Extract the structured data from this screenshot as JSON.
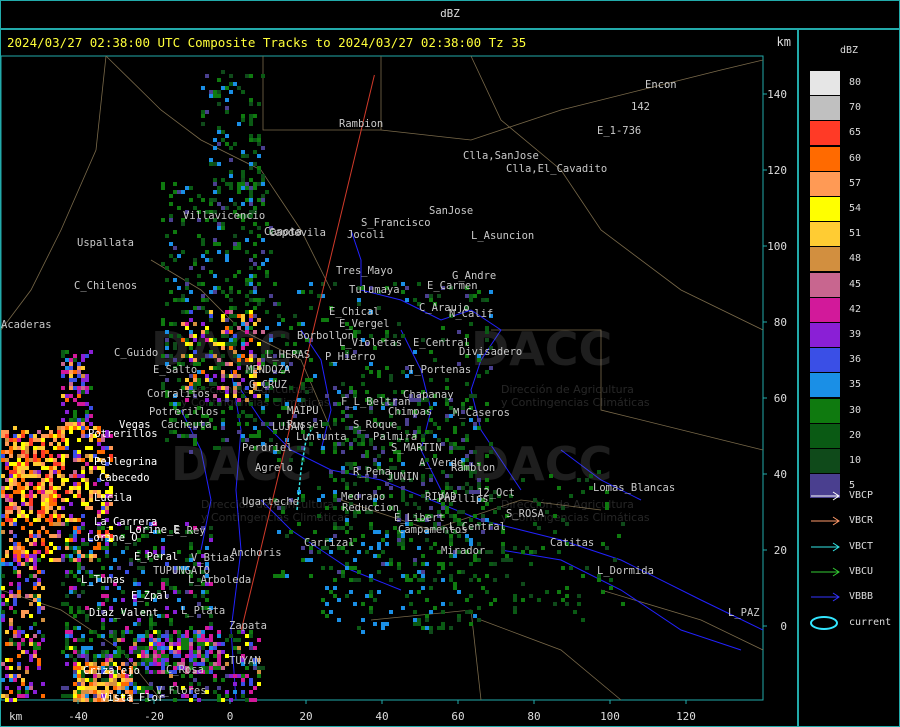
{
  "header": {
    "title": "dBZ"
  },
  "map": {
    "title": "2024/03/27 02:38:00 UTC Composite Tracks to 2024/03/27 02:38:00 Tz 35",
    "unit_top": "km",
    "unit_bottom": "km",
    "x_ticks": [
      "-40",
      "-20",
      "0",
      "20",
      "40",
      "60",
      "80",
      "100",
      "120"
    ],
    "y_ticks": [
      "140",
      "120",
      "100",
      "80",
      "60",
      "40",
      "20",
      "0"
    ],
    "watermark": "DACC",
    "watermark_subtitle_1": "Dirección de Agricultura",
    "watermark_subtitle_2": "y Contingencias Climáticas",
    "places": [
      {
        "name": "Encon"
      },
      {
        "name": "142"
      },
      {
        "name": "E_1-736"
      },
      {
        "name": "Rambion"
      },
      {
        "name": "Clla,SanJose"
      },
      {
        "name": "Clla,El_Cavadito"
      },
      {
        "name": "Villavicencio"
      },
      {
        "name": "Canota"
      },
      {
        "name": "Uspallata"
      },
      {
        "name": "S_Francisco"
      },
      {
        "name": "Jocoli"
      },
      {
        "name": "Capdevila"
      },
      {
        "name": "SanJose"
      },
      {
        "name": "L_Asuncion"
      },
      {
        "name": "Tres_Mayo"
      },
      {
        "name": "G_Andre"
      },
      {
        "name": "E_Carmen"
      },
      {
        "name": "Tulumaya"
      },
      {
        "name": "C_Chilenos"
      },
      {
        "name": "E_Chical"
      },
      {
        "name": "C_Araujo"
      },
      {
        "name": "E_Vergel"
      },
      {
        "name": "N_Calif"
      },
      {
        "name": "Borbollon"
      },
      {
        "name": "L_Violetas"
      },
      {
        "name": "E_Central"
      },
      {
        "name": "C_Guido"
      },
      {
        "name": "L_HERAS"
      },
      {
        "name": "P_Hierro"
      },
      {
        "name": "Divisadero"
      },
      {
        "name": "MENDOZA"
      },
      {
        "name": "E_Salto"
      },
      {
        "name": "T_Portenas"
      },
      {
        "name": "G_CRUZ"
      },
      {
        "name": "Corralitos"
      },
      {
        "name": "Chapanay"
      },
      {
        "name": "F_L_Beltran"
      },
      {
        "name": "Potrerillos"
      },
      {
        "name": "MAIPU"
      },
      {
        "name": "Chimpas"
      },
      {
        "name": "M_Caseros"
      },
      {
        "name": "Vegas"
      },
      {
        "name": "Cacheuta"
      },
      {
        "name": "Russel"
      },
      {
        "name": "S_Roque"
      },
      {
        "name": "Palmira"
      },
      {
        "name": "LUJAN"
      },
      {
        "name": "Lunlunta"
      },
      {
        "name": "S_MARTIN"
      },
      {
        "name": "Potrerillos"
      },
      {
        "name": "Perdriel"
      },
      {
        "name": "Pellegrina"
      },
      {
        "name": "Agrelo"
      },
      {
        "name": "A_Verde"
      },
      {
        "name": "R_Pena"
      },
      {
        "name": "JUNIN"
      },
      {
        "name": "Ramblon"
      },
      {
        "name": "Cabecedo"
      },
      {
        "name": "Lomas_Blancas"
      },
      {
        "name": "Lucila"
      },
      {
        "name": "RIVAD"
      },
      {
        "name": "12_Oct"
      },
      {
        "name": "Medrano"
      },
      {
        "name": "Phillips"
      },
      {
        "name": "Ugarteche"
      },
      {
        "name": "Reduccion"
      },
      {
        "name": "E_Libert"
      },
      {
        "name": "S_ROSA"
      },
      {
        "name": "La_Carrera"
      },
      {
        "name": "L_Central"
      },
      {
        "name": "Lorine_E"
      },
      {
        "name": "Campamentos"
      },
      {
        "name": "E_Rey"
      },
      {
        "name": "Lorine_O"
      },
      {
        "name": "Catitas"
      },
      {
        "name": "Carrizal"
      },
      {
        "name": "Mirador"
      },
      {
        "name": "E_Peral"
      },
      {
        "name": "V_Btias"
      },
      {
        "name": "Anchoris"
      },
      {
        "name": "TUPUNGATO"
      },
      {
        "name": "L_Dormida"
      },
      {
        "name": "L_Tunas"
      },
      {
        "name": "L_Arboleda"
      },
      {
        "name": "E_Zpal"
      },
      {
        "name": "Diaz_Valent"
      },
      {
        "name": "L_Plata"
      },
      {
        "name": "L_PAZ"
      },
      {
        "name": "Zapata"
      },
      {
        "name": "C_Rosa"
      },
      {
        "name": "Crizalejo"
      },
      {
        "name": "TUYAN"
      },
      {
        "name": "V_Flores"
      },
      {
        "name": "Vista_Flor"
      },
      {
        "name": "Acaderas"
      }
    ]
  },
  "legend": {
    "title": "dBZ",
    "levels": [
      {
        "label": "80",
        "color": "#e6e6e6"
      },
      {
        "label": "70",
        "color": "#c0c0c0"
      },
      {
        "label": "65",
        "color": "#ff3a26"
      },
      {
        "label": "60",
        "color": "#ff6a00"
      },
      {
        "label": "57",
        "color": "#ff9a55"
      },
      {
        "label": "54",
        "color": "#ffff00"
      },
      {
        "label": "51",
        "color": "#ffcc33"
      },
      {
        "label": "48",
        "color": "#d28f3f"
      },
      {
        "label": "45",
        "color": "#c8668f"
      },
      {
        "label": "42",
        "color": "#d2199a"
      },
      {
        "label": "39",
        "color": "#8a1fd6"
      },
      {
        "label": "36",
        "color": "#3a4fe6"
      },
      {
        "label": "35",
        "color": "#1a8fe6"
      },
      {
        "label": "30",
        "color": "#0f7a0f"
      },
      {
        "label": "20",
        "color": "#0a5a14"
      },
      {
        "label": "10",
        "color": "#0f4a1a"
      },
      {
        "label": "5",
        "color": "#4a3f8f"
      }
    ],
    "tracks": [
      {
        "label": "VBCP",
        "color": "#ffffff",
        "kind": "arrow"
      },
      {
        "label": "VBCR",
        "color": "#ff9a6a",
        "kind": "arrow"
      },
      {
        "label": "VBCT",
        "color": "#33e6e6",
        "kind": "arrow"
      },
      {
        "label": "VBCU",
        "color": "#33cc33",
        "kind": "arrow"
      },
      {
        "label": "VBBB",
        "color": "#3333ff",
        "kind": "arrow"
      },
      {
        "label": "current",
        "color": "#33e6ff",
        "kind": "ellipse"
      }
    ]
  }
}
